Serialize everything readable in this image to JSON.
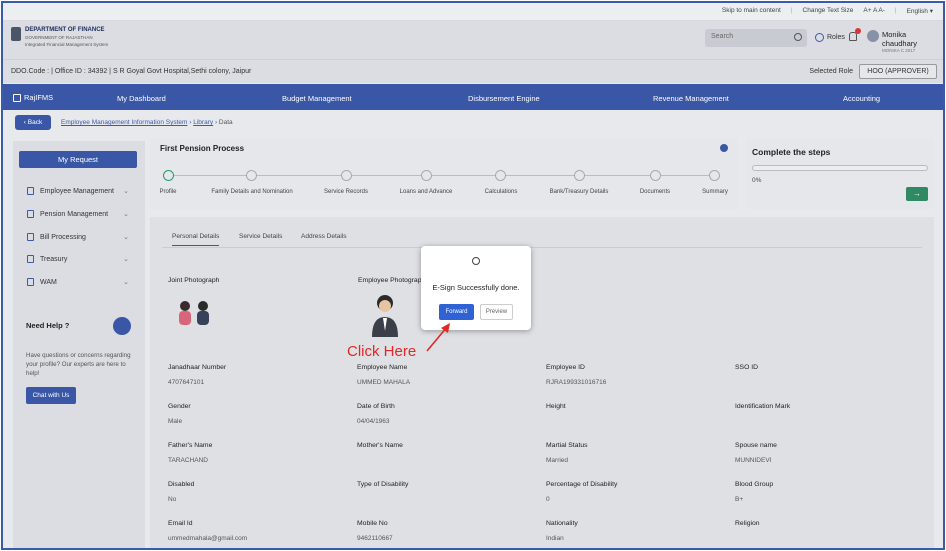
{
  "topbar": {
    "skip": "Skip to main content",
    "change_text": "Change Text Size",
    "text_sizes": "A+  A  A-",
    "language": "English"
  },
  "brand": {
    "title": "DEPARTMENT OF FINANCE",
    "line2": "GOVERNMENT OF RAJASTHAN",
    "line3": "Integrated Financial Management System"
  },
  "header": {
    "search_placeholder": "Search",
    "roles": "Roles",
    "user_name": "Monika chaudhary",
    "user_role": "MONIKA C 2017"
  },
  "ddo": {
    "text": "DDO.Code : | Office ID : 34392 | S R Goyal Govt Hospital,Sethi colony, Jaipur",
    "role_label": "Selected Role",
    "role_value": "HOO (APPROVER)"
  },
  "nav": {
    "home": "RajIFMS",
    "items": [
      "My Dashboard",
      "Budget Management",
      "Disbursement Engine",
      "Revenue Management",
      "Accounting"
    ]
  },
  "breadcrumb": {
    "back": "Back",
    "link1": "Employee Management Information System",
    "link2": "Library",
    "current": "Data"
  },
  "sidebar": {
    "my_request": "My Request",
    "items": [
      "Employee Management",
      "Pension Management",
      "Bill Processing",
      "Treasury",
      "WAM"
    ],
    "need_help": "Need Help ?",
    "help_text": "Have questions or concerns regarding your profile? Our experts are here to help!",
    "chat_button": "Chat with Us"
  },
  "process": {
    "title": "First Pension Process",
    "steps": [
      "Profile",
      "Family Details and Nomination",
      "Service Records",
      "Loans and Advance",
      "Calculations",
      "Bank/Treasury Details",
      "Documents",
      "Summary"
    ]
  },
  "complete": {
    "title": "Complete the steps",
    "percent": "0%",
    "go": "→"
  },
  "tabs": [
    "Personal Details",
    "Service Details",
    "Address Details"
  ],
  "photos": {
    "joint": "Joint Photograph",
    "employee": "Employee Photograph"
  },
  "fields": [
    {
      "label": "Janadhaar Number",
      "value": "4707647101"
    },
    {
      "label": "Employee Name",
      "value": "UMMED MAHALA"
    },
    {
      "label": "Employee ID",
      "value": "RJRA199331016716"
    },
    {
      "label": "SSO ID",
      "value": ""
    },
    {
      "label": "Gender",
      "value": "Male"
    },
    {
      "label": "Date of Birth",
      "value": "04/04/1963"
    },
    {
      "label": "Height",
      "value": ""
    },
    {
      "label": "Identification Mark",
      "value": ""
    },
    {
      "label": "Father's Name",
      "value": "TARACHAND"
    },
    {
      "label": "Mother's Name",
      "value": ""
    },
    {
      "label": "Martial Status",
      "value": "Married"
    },
    {
      "label": "Spouse name",
      "value": "MUNNIDEVI"
    },
    {
      "label": "Disabled",
      "value": "No"
    },
    {
      "label": "Type of Disability",
      "value": ""
    },
    {
      "label": "Percentage of Disability",
      "value": "0"
    },
    {
      "label": "Blood Group",
      "value": "B+"
    },
    {
      "label": "Email Id",
      "value": "ummedmahala@gmail.com"
    },
    {
      "label": "Mobile No",
      "value": "9462110667"
    },
    {
      "label": "Nationality",
      "value": "Indian"
    },
    {
      "label": "Religion",
      "value": ""
    }
  ],
  "modal": {
    "message": "E-Sign Successfully done.",
    "forward": "Forward",
    "preview": "Preview"
  },
  "annotation": {
    "text": "Click Here",
    "color": "#e12727"
  }
}
